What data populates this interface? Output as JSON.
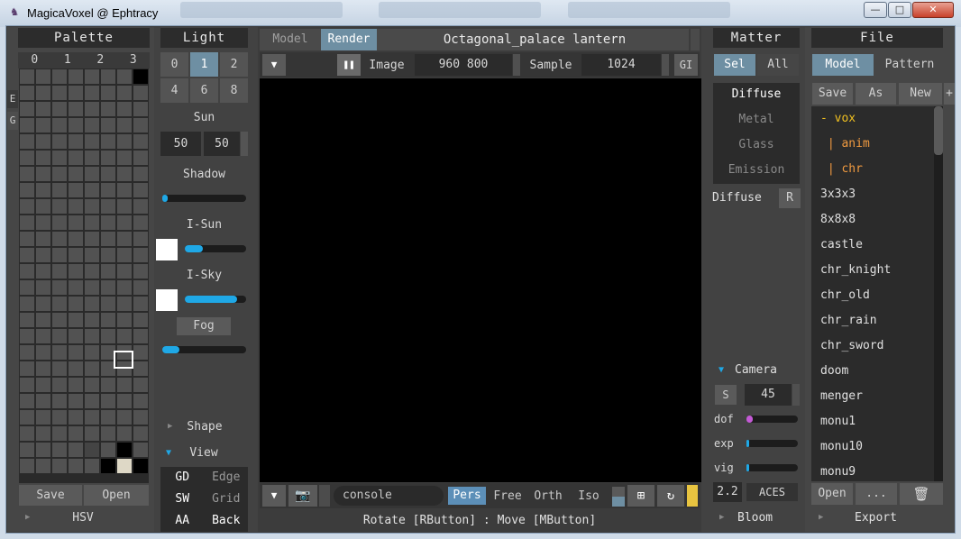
{
  "window": {
    "title": "MagicaVoxel @ Ephtracy",
    "min": "—",
    "max": "□",
    "close": "✕"
  },
  "palette": {
    "header": "Palette",
    "columns": [
      "0",
      "1",
      "2",
      "3"
    ],
    "side_tabs": [
      "E",
      "G"
    ],
    "save": "Save",
    "open": "Open",
    "hsv": "HSV"
  },
  "light": {
    "header": "Light",
    "presets": [
      "0",
      "1",
      "2",
      "4",
      "6",
      "8"
    ],
    "sun_label": "Sun",
    "sun_values": [
      "50",
      "50"
    ],
    "shadow_label": "Shadow",
    "shadow_value": 0.04,
    "isun_label": "I-Sun",
    "isun_value": 0.3,
    "isky_label": "I-Sky",
    "isky_value": 0.85,
    "fog_label": "Fog",
    "fog_value": 0.2,
    "shape_label": "Shape",
    "view_label": "View",
    "view_toggles": [
      [
        "GD",
        "Edge"
      ],
      [
        "SW",
        "Grid"
      ],
      [
        "AA",
        "Back"
      ]
    ]
  },
  "center": {
    "tabs": [
      "Model",
      "Render"
    ],
    "active_tab": "Render",
    "model_name": "Octagonal_palace lantern",
    "image_label": "Image",
    "image_size": "960 800",
    "sample_label": "Sample",
    "sample_value": "1024",
    "gi_label": "GI",
    "console_placeholder": "console",
    "projections": [
      "Pers",
      "Free",
      "Orth",
      "Iso"
    ],
    "active_projection": "Pers",
    "status": "Rotate [RButton] : Move [MButton]"
  },
  "matter": {
    "header": "Matter",
    "tabs": [
      "Sel",
      "All"
    ],
    "materials": [
      "Diffuse",
      "Metal",
      "Glass",
      "Emission"
    ],
    "current_label": "Diffuse",
    "r_button": "R",
    "camera_label": "Camera",
    "camera_s": "S",
    "camera_fov": "45",
    "sliders": [
      {
        "label": "dof",
        "value": 0.12,
        "color": "#c45ad6"
      },
      {
        "label": "exp",
        "value": 0.0,
        "color": "#1fa8e6"
      },
      {
        "label": "vig",
        "value": 0.0,
        "color": "#1fa8e6"
      }
    ],
    "gamma": "2.2",
    "tonemap": "ACES",
    "bloom_label": "Bloom"
  },
  "file": {
    "header": "File",
    "tabs": [
      "Model",
      "Pattern"
    ],
    "actions": [
      "Save",
      "As",
      "New",
      "+"
    ],
    "items": [
      {
        "name": "- vox",
        "color": "#f0c020"
      },
      {
        "name": " | anim",
        "color": "#f09a40"
      },
      {
        "name": " | chr",
        "color": "#f09a40"
      },
      {
        "name": "3x3x3",
        "color": "#e0e0e0"
      },
      {
        "name": "8x8x8",
        "color": "#e0e0e0"
      },
      {
        "name": "castle",
        "color": "#e0e0e0"
      },
      {
        "name": "chr_knight",
        "color": "#e0e0e0"
      },
      {
        "name": "chr_old",
        "color": "#e0e0e0"
      },
      {
        "name": "chr_rain",
        "color": "#e0e0e0"
      },
      {
        "name": "chr_sword",
        "color": "#e0e0e0"
      },
      {
        "name": "doom",
        "color": "#e0e0e0"
      },
      {
        "name": "menger",
        "color": "#e0e0e0"
      },
      {
        "name": "monu1",
        "color": "#e0e0e0"
      },
      {
        "name": "monu10",
        "color": "#e0e0e0"
      },
      {
        "name": "monu9",
        "color": "#e0e0e0"
      }
    ],
    "open": "Open",
    "more": "...",
    "export_label": "Export"
  }
}
